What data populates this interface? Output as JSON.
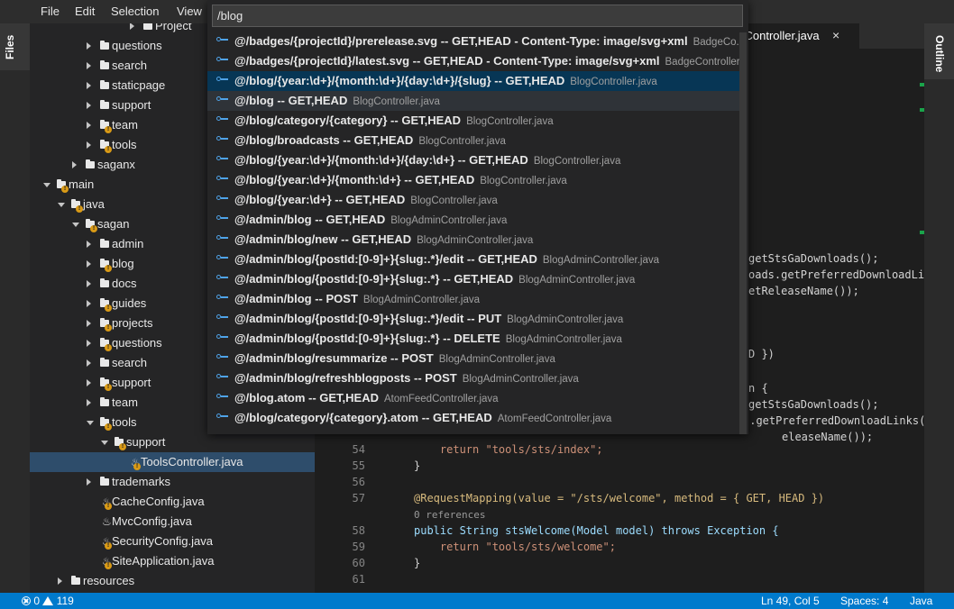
{
  "menubar": {
    "file": "File",
    "edit": "Edit",
    "selection": "Selection",
    "view": "View"
  },
  "sidebar": {
    "files_tab": "Files"
  },
  "explorer": {
    "items": [
      {
        "label": "Project",
        "kind": "folder",
        "state": "collapsed",
        "warning": false
      },
      {
        "label": "questions",
        "kind": "folder",
        "state": "collapsed",
        "warning": false
      },
      {
        "label": "search",
        "kind": "folder",
        "state": "collapsed",
        "warning": false
      },
      {
        "label": "staticpage",
        "kind": "folder",
        "state": "collapsed",
        "warning": false
      },
      {
        "label": "support",
        "kind": "folder",
        "state": "collapsed",
        "warning": false
      },
      {
        "label": "team",
        "kind": "folder",
        "state": "collapsed",
        "warning": true
      },
      {
        "label": "tools",
        "kind": "folder",
        "state": "collapsed",
        "warning": true
      },
      {
        "label": "saganx",
        "kind": "folder",
        "state": "collapsed",
        "warning": false
      },
      {
        "label": "main",
        "kind": "folder",
        "state": "expanded",
        "warning": true
      },
      {
        "label": "java",
        "kind": "folder",
        "state": "expanded",
        "warning": true
      },
      {
        "label": "sagan",
        "kind": "folder",
        "state": "expanded",
        "warning": true
      },
      {
        "label": "admin",
        "kind": "folder",
        "state": "collapsed",
        "warning": false
      },
      {
        "label": "blog",
        "kind": "folder",
        "state": "collapsed",
        "warning": true
      },
      {
        "label": "docs",
        "kind": "folder",
        "state": "collapsed",
        "warning": false
      },
      {
        "label": "guides",
        "kind": "folder",
        "state": "collapsed",
        "warning": true
      },
      {
        "label": "projects",
        "kind": "folder",
        "state": "collapsed",
        "warning": true
      },
      {
        "label": "questions",
        "kind": "folder",
        "state": "collapsed",
        "warning": true
      },
      {
        "label": "search",
        "kind": "folder",
        "state": "collapsed",
        "warning": false
      },
      {
        "label": "support",
        "kind": "folder",
        "state": "collapsed",
        "warning": true
      },
      {
        "label": "team",
        "kind": "folder",
        "state": "collapsed",
        "warning": false
      },
      {
        "label": "tools",
        "kind": "folder",
        "state": "expanded",
        "warning": true
      },
      {
        "label": "support",
        "kind": "folder",
        "state": "expanded",
        "warning": true
      },
      {
        "label": "ToolsController.java",
        "kind": "file",
        "state": "none",
        "warning": true
      },
      {
        "label": "trademarks",
        "kind": "folder",
        "state": "collapsed",
        "warning": false
      },
      {
        "label": "CacheConfig.java",
        "kind": "file",
        "state": "none",
        "warning": true
      },
      {
        "label": "MvcConfig.java",
        "kind": "file",
        "state": "none",
        "warning": false
      },
      {
        "label": "SecurityConfig.java",
        "kind": "file",
        "state": "none",
        "warning": true
      },
      {
        "label": "SiteApplication.java",
        "kind": "file",
        "state": "none",
        "warning": true
      },
      {
        "label": "resources",
        "kind": "folder",
        "state": "collapsed",
        "warning": false
      }
    ]
  },
  "editor": {
    "active_tab": "sController.java",
    "close_icon": "×",
    "visible_fragments": [
      "getStsGaDownloads();",
      "oads.getPreferredDownloadLin",
      "etReleaseName());",
      "D })",
      "n {",
      "getStsGaDownloads();",
      "s.getPreferredDownloadLinks(",
      "eleaseName());"
    ],
    "lines": [
      {
        "num": "54",
        "code": "    return \"tools/sts/index\";"
      },
      {
        "num": "55",
        "code": "}"
      },
      {
        "num": "56",
        "code": ""
      },
      {
        "num": "57",
        "code": "@RequestMapping(value = \"/sts/welcome\", method = { GET, HEAD })"
      },
      {
        "num": "",
        "code": "0 references"
      },
      {
        "num": "58",
        "code": "public String stsWelcome(Model model) throws Exception {"
      },
      {
        "num": "59",
        "code": "    return \"tools/sts/welcome\";"
      },
      {
        "num": "60",
        "code": "}"
      },
      {
        "num": "61",
        "code": ""
      }
    ]
  },
  "outline": {
    "tab": "Outline"
  },
  "statusbar": {
    "errors": "0",
    "warnings": "119",
    "position": "Ln 49, Col 5",
    "spaces": "Spaces: 4",
    "language": "Java"
  },
  "quick_open": {
    "query": "/blog",
    "icon": "route-icon",
    "results": [
      {
        "label": "@/badges/{projectId}/prerelease.svg -- GET,HEAD - Content-Type: image/svg+xml",
        "desc": "BadgeCo..."
      },
      {
        "label": "@/badges/{projectId}/latest.svg -- GET,HEAD - Content-Type: image/svg+xml",
        "desc": "BadgeController..."
      },
      {
        "label": "@/blog/{year:\\d+}/{month:\\d+}/{day:\\d+}/{slug} -- GET,HEAD",
        "desc": "BlogController.java",
        "state": "focused"
      },
      {
        "label": "@/blog -- GET,HEAD",
        "desc": "BlogController.java",
        "state": "hover"
      },
      {
        "label": "@/blog/category/{category} -- GET,HEAD",
        "desc": "BlogController.java"
      },
      {
        "label": "@/blog/broadcasts -- GET,HEAD",
        "desc": "BlogController.java"
      },
      {
        "label": "@/blog/{year:\\d+}/{month:\\d+}/{day:\\d+} -- GET,HEAD",
        "desc": "BlogController.java"
      },
      {
        "label": "@/blog/{year:\\d+}/{month:\\d+} -- GET,HEAD",
        "desc": "BlogController.java"
      },
      {
        "label": "@/blog/{year:\\d+} -- GET,HEAD",
        "desc": "BlogController.java"
      },
      {
        "label": "@/admin/blog -- GET,HEAD",
        "desc": "BlogAdminController.java"
      },
      {
        "label": "@/admin/blog/new -- GET,HEAD",
        "desc": "BlogAdminController.java"
      },
      {
        "label": "@/admin/blog/{postId:[0-9]+}{slug:.*}/edit -- GET,HEAD",
        "desc": "BlogAdminController.java"
      },
      {
        "label": "@/admin/blog/{postId:[0-9]+}{slug:.*} -- GET,HEAD",
        "desc": "BlogAdminController.java"
      },
      {
        "label": "@/admin/blog -- POST",
        "desc": "BlogAdminController.java"
      },
      {
        "label": "@/admin/blog/{postId:[0-9]+}{slug:.*}/edit -- PUT",
        "desc": "BlogAdminController.java"
      },
      {
        "label": "@/admin/blog/{postId:[0-9]+}{slug:.*} -- DELETE",
        "desc": "BlogAdminController.java"
      },
      {
        "label": "@/admin/blog/resummarize -- POST",
        "desc": "BlogAdminController.java"
      },
      {
        "label": "@/admin/blog/refreshblogposts -- POST",
        "desc": "BlogAdminController.java"
      },
      {
        "label": "@/blog.atom -- GET,HEAD",
        "desc": "AtomFeedController.java"
      },
      {
        "label": "@/blog/category/{category}.atom -- GET,HEAD",
        "desc": "AtomFeedController.java"
      }
    ]
  },
  "colors": {
    "statusbar": "#007acc",
    "focused_row": "#073655",
    "route_icon": "#4fa3e8",
    "warning_badge": "#d99a16"
  }
}
